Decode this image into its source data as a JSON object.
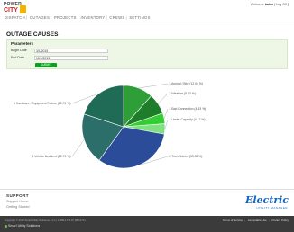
{
  "brand": {
    "line1": "POWER",
    "line2": "CITY"
  },
  "header": {
    "welcome_prefix": "Welcome",
    "user": "bakkr",
    "logout": "[ Log Off ]"
  },
  "nav": {
    "items": [
      "DISPATCH",
      "OUTAGES",
      "PROJECTS",
      "INVENTORY",
      "CREWS",
      "SETTINGS"
    ],
    "separator": "|"
  },
  "page": {
    "title": "OUTAGE CAUSES"
  },
  "parameters": {
    "title": "Parameters",
    "begin_label": "Begin Date",
    "begin_value": "3/1/2015",
    "end_label": "End Date",
    "end_value": "10/1/2013",
    "submit_label": "SUBMIT"
  },
  "chart_data": {
    "type": "pie",
    "title": "",
    "slices": [
      {
        "label": "3 Animal / Bird (12.04 %)",
        "value": 12.04,
        "color": "#2e9e36"
      },
      {
        "label": "2 Weather (8.33 %)",
        "value": 8.33,
        "color": "#1e7d2a"
      },
      {
        "label": "1 Bad Connection (4.33 %)",
        "value": 4.33,
        "color": "#33cc33"
      },
      {
        "label": "1 Under Capacity (4.17 %)",
        "value": 4.17,
        "color": "#7fe07f"
      },
      {
        "label": "8 Trees/Limbs (33.33 %)",
        "value": 33.33,
        "color": "#2b4d99"
      },
      {
        "label": "5 Vehicle Accident (20.74 %)",
        "value": 20.74,
        "color": "#2c6f6a"
      },
      {
        "label": "5 Hardware / Equipment Failure (20.74 %)",
        "value": 20.74,
        "color": "#1f6b55"
      }
    ]
  },
  "footer": {
    "support_title": "SUPPORT",
    "links": [
      "Support Home",
      "Getting Started"
    ],
    "brand_name": "Electric",
    "brand_tagline": "UTILITY MANAGER",
    "copyright": "Copyright © 2015 Smart Utility Solutions, LLC  |  1-888-1773-8 | 888-0741",
    "product": "Smart Utility Solutions",
    "legal_links": [
      "Terms of Service",
      "Acceptable Use",
      "Privacy Policy"
    ]
  }
}
